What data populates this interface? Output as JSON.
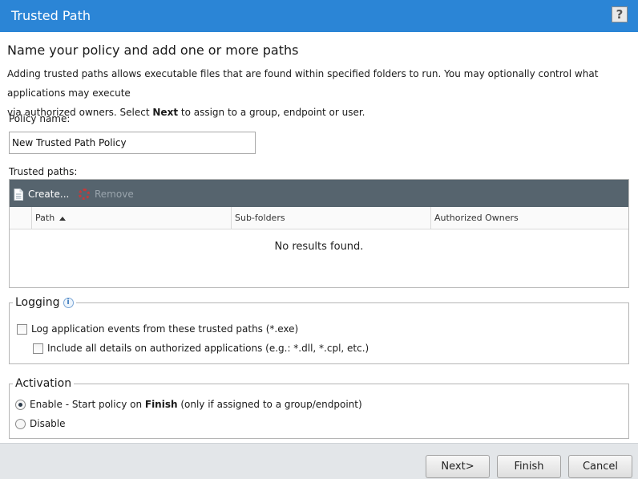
{
  "window": {
    "title": "Trusted Path",
    "help_label": "?"
  },
  "heading": "Name your policy and add one or more paths",
  "description": {
    "line1": "Adding trusted paths allows executable files that are found within specified folders to run. You may optionally control what applications may execute",
    "line2_prefix": "via authorized owners. Select ",
    "line2_bold": "Next",
    "line2_suffix": " to assign to a group, endpoint or user."
  },
  "policy": {
    "label": "Policy name:",
    "value": "New Trusted Path Policy"
  },
  "trusted_paths": {
    "label": "Trusted paths:",
    "toolbar": {
      "create_label": "Create...",
      "remove_label": "Remove"
    },
    "columns": [
      "Path",
      "Sub-folders",
      "Authorized Owners"
    ],
    "sort_column": "Path",
    "empty_text": "No results found."
  },
  "logging": {
    "legend": "Logging",
    "info_icon": "i",
    "options": [
      {
        "label": "Log application events from these trusted paths (*.exe)",
        "checked": false
      },
      {
        "label": "Include all details on authorized applications (e.g.: *.dll, *.cpl, etc.)",
        "checked": false
      }
    ]
  },
  "activation": {
    "legend": "Activation",
    "enable": {
      "prefix": "Enable - Start policy on ",
      "bold": "Finish",
      "suffix": " (only if assigned to a group/endpoint)",
      "selected": true
    },
    "disable": {
      "label": "Disable",
      "selected": false
    }
  },
  "footer": {
    "next_label": "Next>",
    "finish_label": "Finish",
    "cancel_label": "Cancel"
  },
  "colors": {
    "titlebar": "#2b85d6",
    "toolbar": "#56646e",
    "footer": "#e3e6e9"
  }
}
